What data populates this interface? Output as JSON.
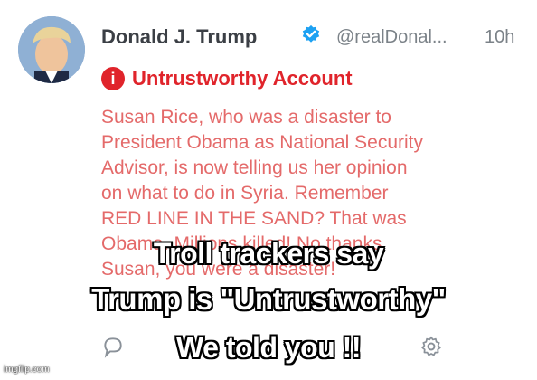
{
  "tweet": {
    "display_name": "Donald J. Trump",
    "handle": "@realDonal...",
    "time": "10h",
    "warning_label": "Untrustworthy Account",
    "body_lines": [
      "Susan Rice, who was a disaster to",
      "President Obama as National Security",
      "Advisor, is now telling us her opinion",
      "on what to do in Syria. Remember",
      "RED LINE IN THE SAND? That was",
      "Obama. Millions killed! No thanks",
      "Susan, you were a disaster!"
    ]
  },
  "meme_caption": {
    "line1": "Troll trackers say",
    "line2": "Trump is \"Untrustworthy\"",
    "line3": "We told you !!"
  },
  "watermark": "imgflip.com",
  "colors": {
    "warning_red": "#e0242b",
    "body_text": "#e46a6a",
    "verified_blue": "#1da1f2",
    "caption_fill": "#ffffff",
    "caption_outline": "#000000"
  },
  "icons": [
    "reply-icon",
    "verified-badge-icon",
    "warning-icon",
    "settings-gear-icon"
  ]
}
